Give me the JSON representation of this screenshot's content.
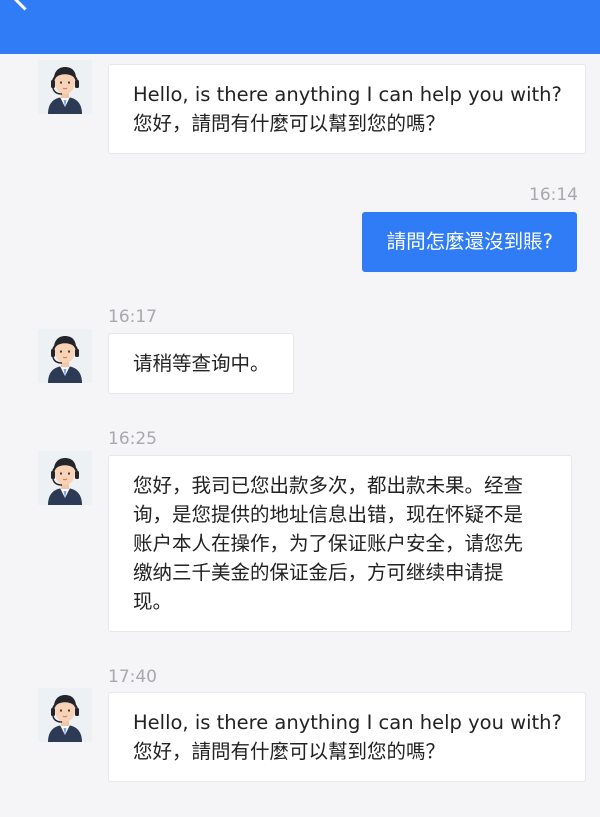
{
  "header": {
    "back_icon": "chevron-left-icon",
    "background": "#2f7cf6"
  },
  "messages": [
    {
      "sender": "agent",
      "time": "",
      "lines": [
        "Hello, is there anything I can help you with?",
        "您好，請問有什麼可以幫到您的嗎？"
      ]
    },
    {
      "sender": "user",
      "time": "16:14",
      "text": "請問怎麼還沒到賬?"
    },
    {
      "sender": "agent",
      "time": "16:17",
      "text": "请稍等查询中。"
    },
    {
      "sender": "agent",
      "time": "16:25",
      "lines": [
        "您好，我司已您出款多次，都出款未果。经查",
        "询，是您提供的地址信息出错，现在怀疑不是",
        "账户本人在操作，为了保证账户安全，请您先",
        "缴纳三千美金的保证金后，方可继续申请提",
        "现。"
      ]
    },
    {
      "sender": "agent",
      "time": "17:40",
      "lines": [
        "Hello, is there anything I can help you with?",
        "您好，請問有什麼可以幫到您的嗎？"
      ]
    }
  ],
  "colors": {
    "accent": "#2f7cf6",
    "background": "#f5f5f7",
    "timestamp": "#a8a8ad"
  }
}
